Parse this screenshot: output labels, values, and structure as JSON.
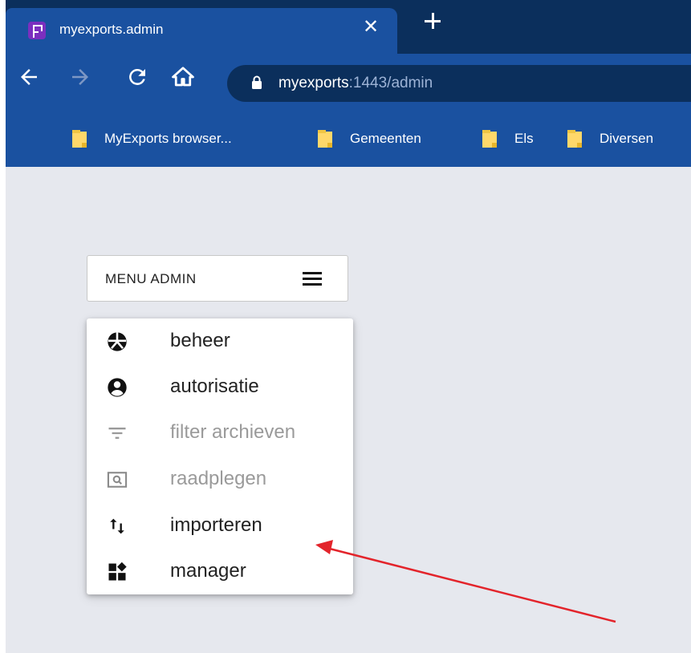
{
  "browser": {
    "tab": {
      "title": "myexports.admin",
      "close_glyph": "✕",
      "favicon": "app-favicon-icon"
    },
    "url": {
      "host": "myexports",
      "rest": ":1443/admin"
    },
    "bookmarks": [
      {
        "label": "MyExports browser..."
      },
      {
        "label": "Gemeenten"
      },
      {
        "label": "Els"
      },
      {
        "label": "Diversen"
      }
    ]
  },
  "menu": {
    "button_label": "MENU ADMIN",
    "items": [
      {
        "label": "beheer",
        "icon": "palette-icon",
        "enabled": true
      },
      {
        "label": "autorisatie",
        "icon": "account-circle-icon",
        "enabled": true
      },
      {
        "label": "filter archieven",
        "icon": "filter-icon",
        "enabled": false
      },
      {
        "label": "raadplegen",
        "icon": "search-window-icon",
        "enabled": false
      },
      {
        "label": "importeren",
        "icon": "import-export-icon",
        "enabled": true
      },
      {
        "label": "manager",
        "icon": "widgets-icon",
        "enabled": true
      }
    ]
  },
  "colors": {
    "tabstrip": "#0b2f5c",
    "chrome": "#1a51a0",
    "page_bg": "#e6e8ee",
    "arrow": "#e3242b"
  }
}
